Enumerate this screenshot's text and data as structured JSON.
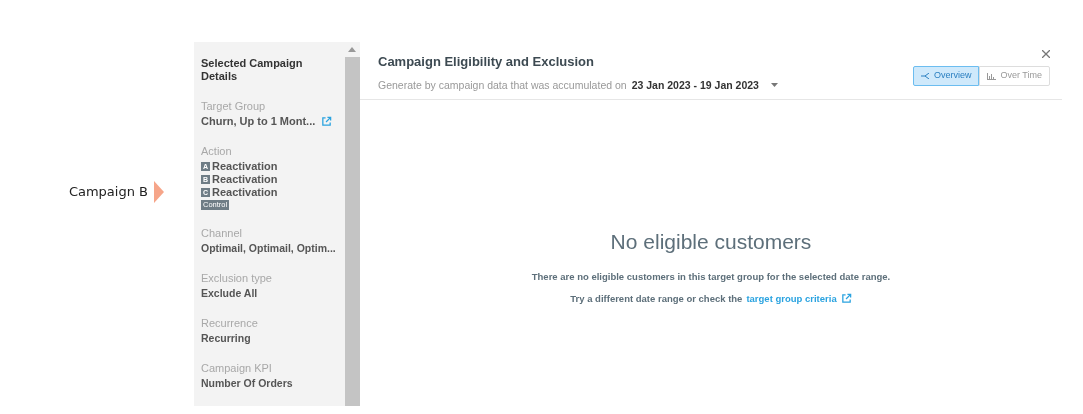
{
  "campaign_label": "Campaign B",
  "sidebar": {
    "title": "Selected Campaign Details",
    "sections": [
      {
        "kind": "link",
        "label": "Target Group",
        "value": "Churn, Up to 1 Mont..."
      },
      {
        "kind": "actions",
        "label": "Action",
        "actions": [
          {
            "letter": "A",
            "name": "Reactivation"
          },
          {
            "letter": "B",
            "name": "Reactivation"
          },
          {
            "letter": "C",
            "name": "Reactivation"
          }
        ],
        "badge": "Control"
      },
      {
        "kind": "text",
        "label": "Channel",
        "value": "Optimail, Optimail, Optim..."
      },
      {
        "kind": "text",
        "label": "Exclusion type",
        "value": "Exclude All"
      },
      {
        "kind": "text",
        "label": "Recurrence",
        "value": "Recurring"
      },
      {
        "kind": "text",
        "label": "Campaign KPI",
        "value": "Number Of Orders"
      }
    ]
  },
  "main": {
    "title": "Campaign Eligibility and Exclusion",
    "subtitle": "Generate by campaign data that was accumulated on",
    "date_range": "23 Jan 2023 - 19 Jan 2023",
    "tabs": [
      {
        "label": "Overview",
        "selected": true
      },
      {
        "label": "Over Time",
        "selected": false
      }
    ],
    "empty": {
      "heading": "No eligible customers",
      "message": "There are no eligible customers in this target group for the selected date range.",
      "hint": "Try a different date range or check the",
      "link": "target group criteria"
    }
  }
}
